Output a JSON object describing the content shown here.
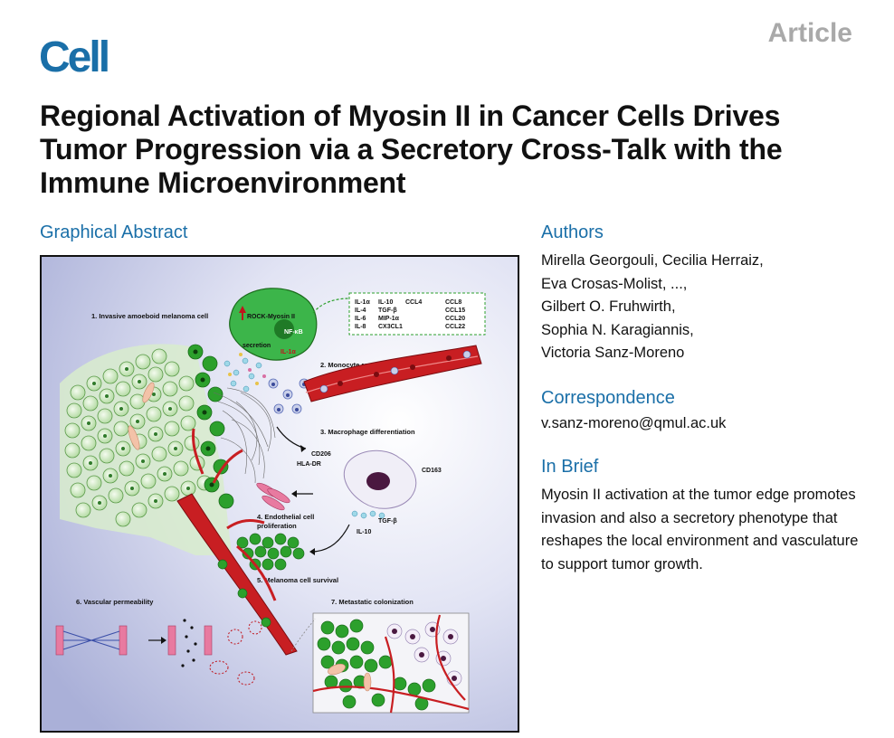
{
  "journal": {
    "logo": "Cell",
    "article_type": "Article"
  },
  "title": "Regional Activation of Myosin II in Cancer Cells Drives Tumor Progression via a Secretory Cross-Talk with the Immune Microenvironment",
  "graphical_abstract": {
    "heading": "Graphical Abstract",
    "labels": {
      "step1": "1. Invasive amoeboid melanoma cell",
      "step2": "2. Monocyte recruitment",
      "step3": "3. Macrophage differentiation",
      "step4a": "4. Endothelial cell",
      "step4b": "proliferation",
      "step5": "5. Melanoma cell survival",
      "step6": "6. Vascular permeability",
      "step7": "7. Metastatic colonization",
      "rock": "ROCK-Myosin II",
      "secretion": "secretion",
      "nfkb": "NF-κB",
      "il1a_inner": "IL-1α",
      "cd206": "CD206",
      "hladr": "HLA-DR",
      "cd163": "CD163",
      "tgfb": "TGF-β",
      "il10": "IL-10"
    },
    "cytokines": [
      [
        "IL-1α",
        "IL-10",
        "CCL4",
        "CCL8"
      ],
      [
        "IL-4",
        "TGF-β",
        "",
        "CCL15"
      ],
      [
        "IL-6",
        "MIP-1α",
        "",
        "CCL20"
      ],
      [
        "IL-8",
        "CX3CL1",
        "",
        "CCL22"
      ]
    ]
  },
  "authors": {
    "heading": "Authors",
    "lines": [
      "Mirella Georgouli, Cecilia Herraiz,",
      "Eva Crosas-Molist, ...,",
      "Gilbert O. Fruhwirth,",
      "Sophia N. Karagiannis,",
      "Victoria Sanz-Moreno"
    ]
  },
  "correspondence": {
    "heading": "Correspondence",
    "email": "v.sanz-moreno@qmul.ac.uk"
  },
  "in_brief": {
    "heading": "In Brief",
    "text": "Myosin II activation at the tumor edge promotes invasion and also a secretory phenotype that reshapes the local environment and vasculature to support tumor growth."
  },
  "colors": {
    "brand": "#1a6fa8",
    "article_gray": "#a9a9a9",
    "cell_green": "#3aa53a",
    "vessel_red": "#c0141c"
  }
}
